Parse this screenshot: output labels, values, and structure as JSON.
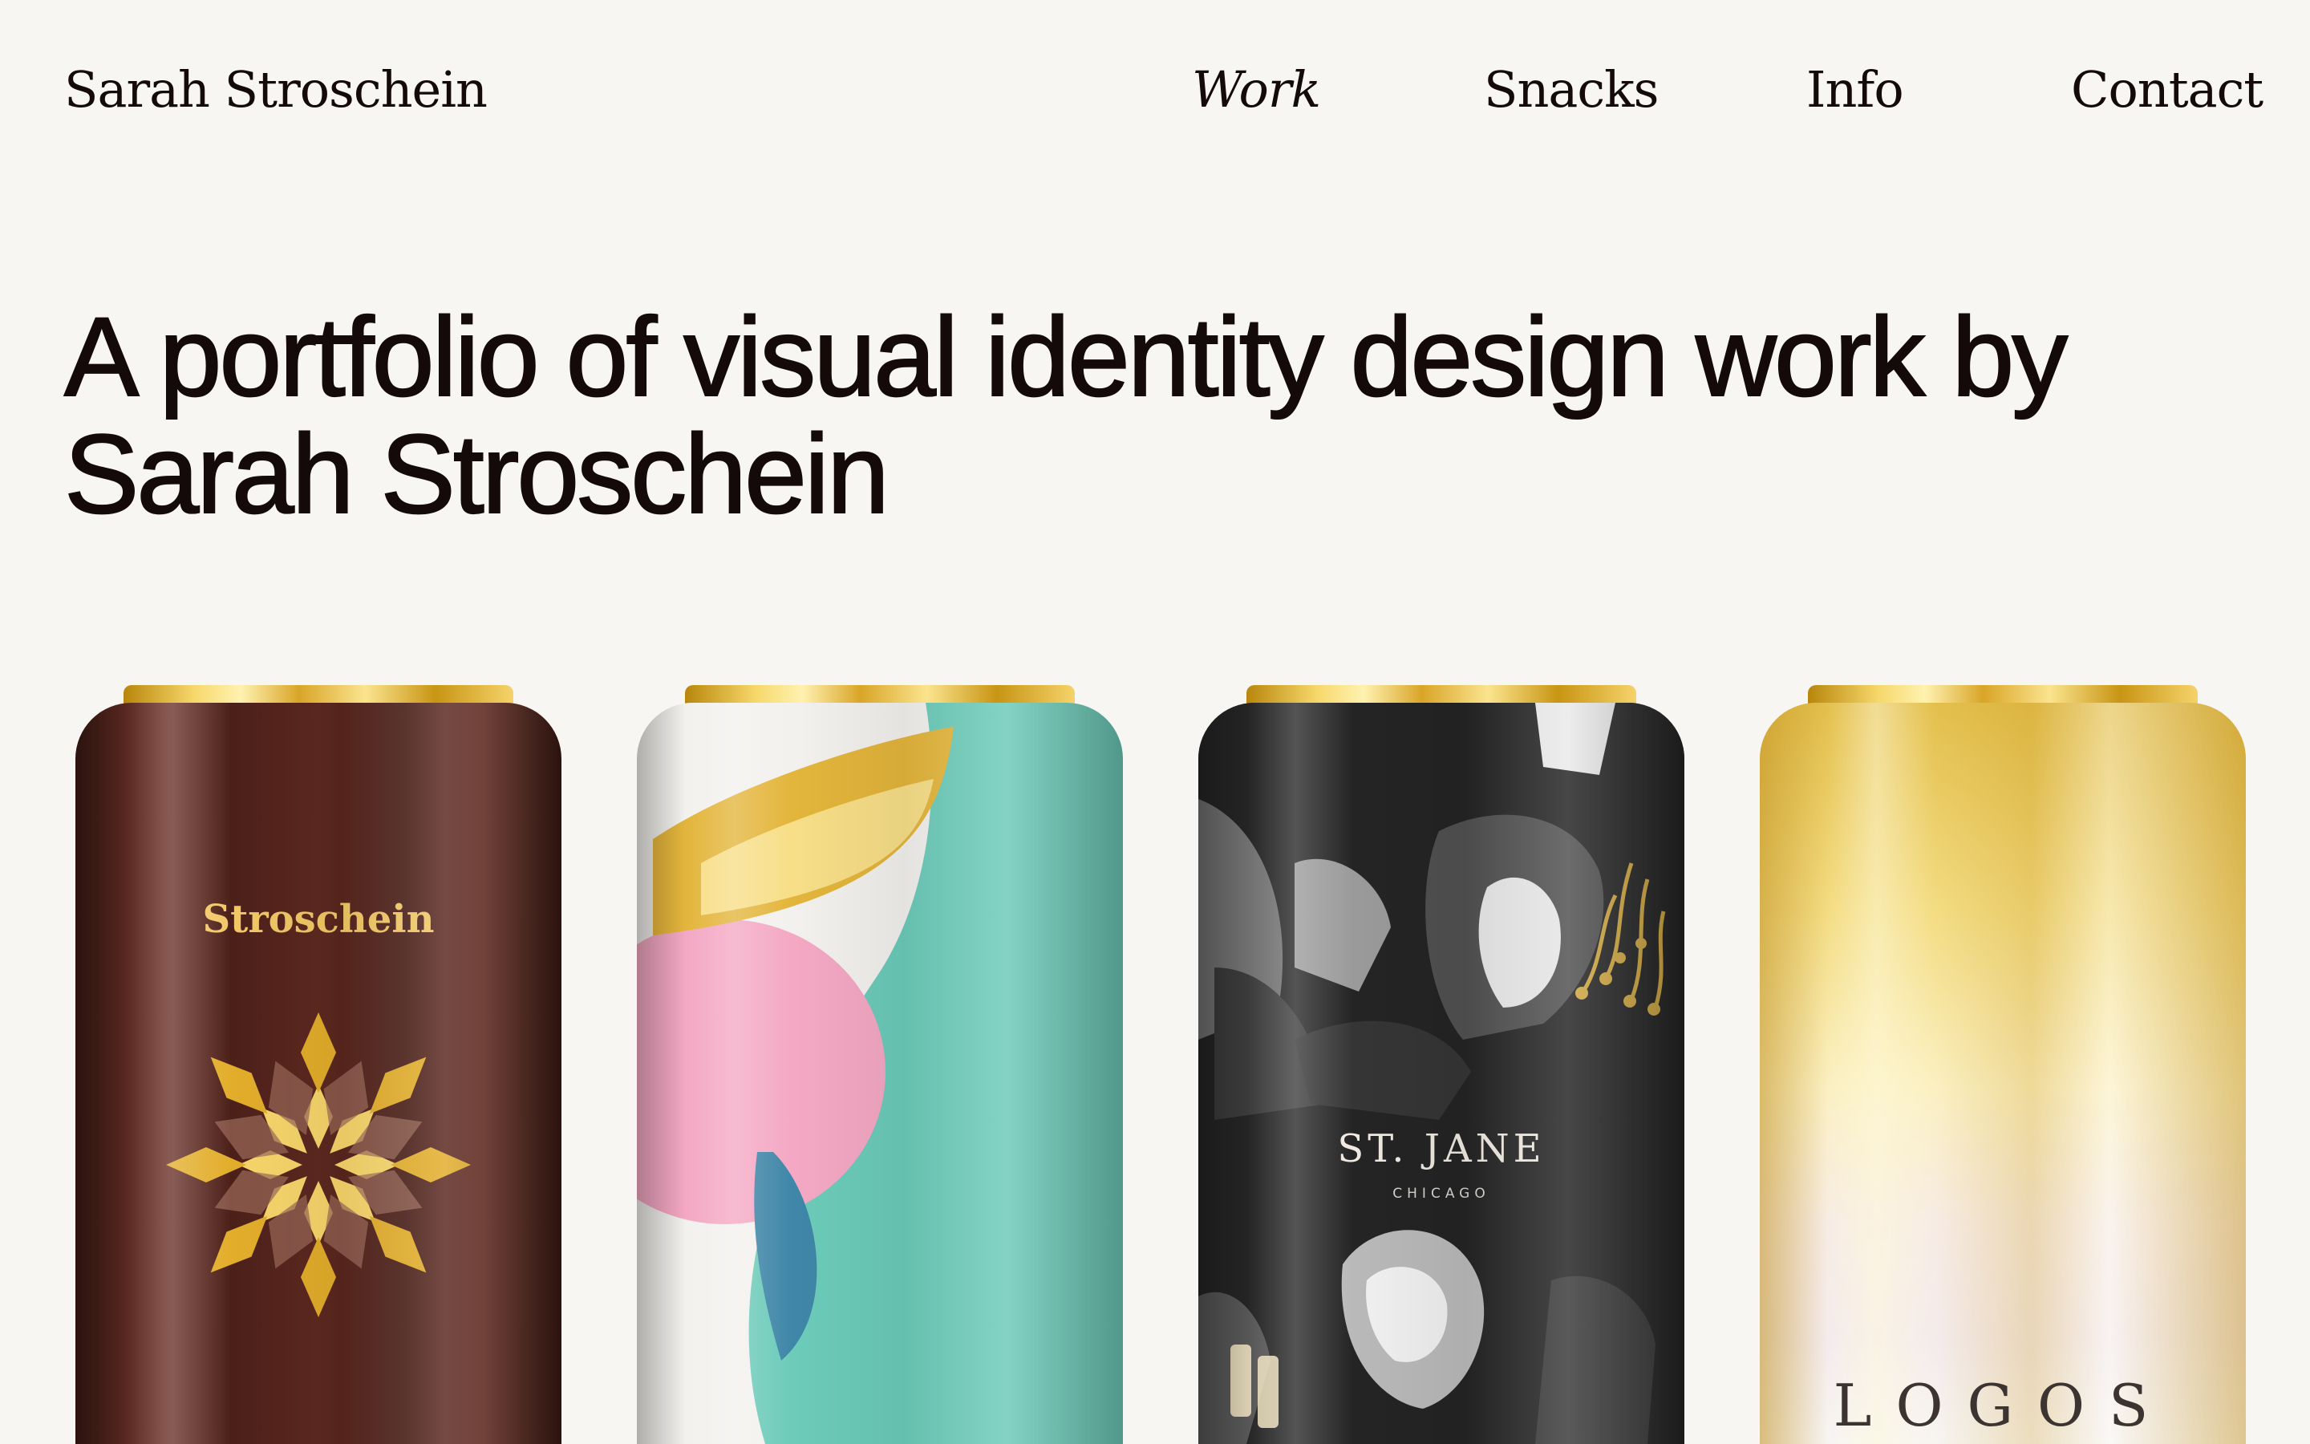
{
  "header": {
    "site_name": "Sarah Stroschein",
    "nav": [
      {
        "label": "Work",
        "active": true
      },
      {
        "label": "Snacks",
        "active": false
      },
      {
        "label": "Info",
        "active": false
      },
      {
        "label": "Contact",
        "active": false
      }
    ]
  },
  "hero": {
    "title": "A portfolio of visual identity design work by Sarah Stroschein"
  },
  "projects": [
    {
      "label": "Stroschein",
      "icon": "starburst-icon",
      "colors": [
        "#5a2a22",
        "#f2c866"
      ]
    },
    {
      "label": "",
      "icon": "abstract-shapes-icon",
      "colors": [
        "#6ccbb9",
        "#f4a8c3",
        "#3f86a8",
        "#e3b53b"
      ]
    },
    {
      "label": "ST. JANE",
      "sublabel": "CHICAGO",
      "icon": "figures-icon",
      "colors": [
        "#222222",
        "#d2a942"
      ]
    },
    {
      "label": "LOGOS",
      "icon": "",
      "colors": [
        "#e3bf4c",
        "#f4ebec"
      ]
    }
  ],
  "colors": {
    "background": "#f7f6f2",
    "text": "#140a09"
  }
}
